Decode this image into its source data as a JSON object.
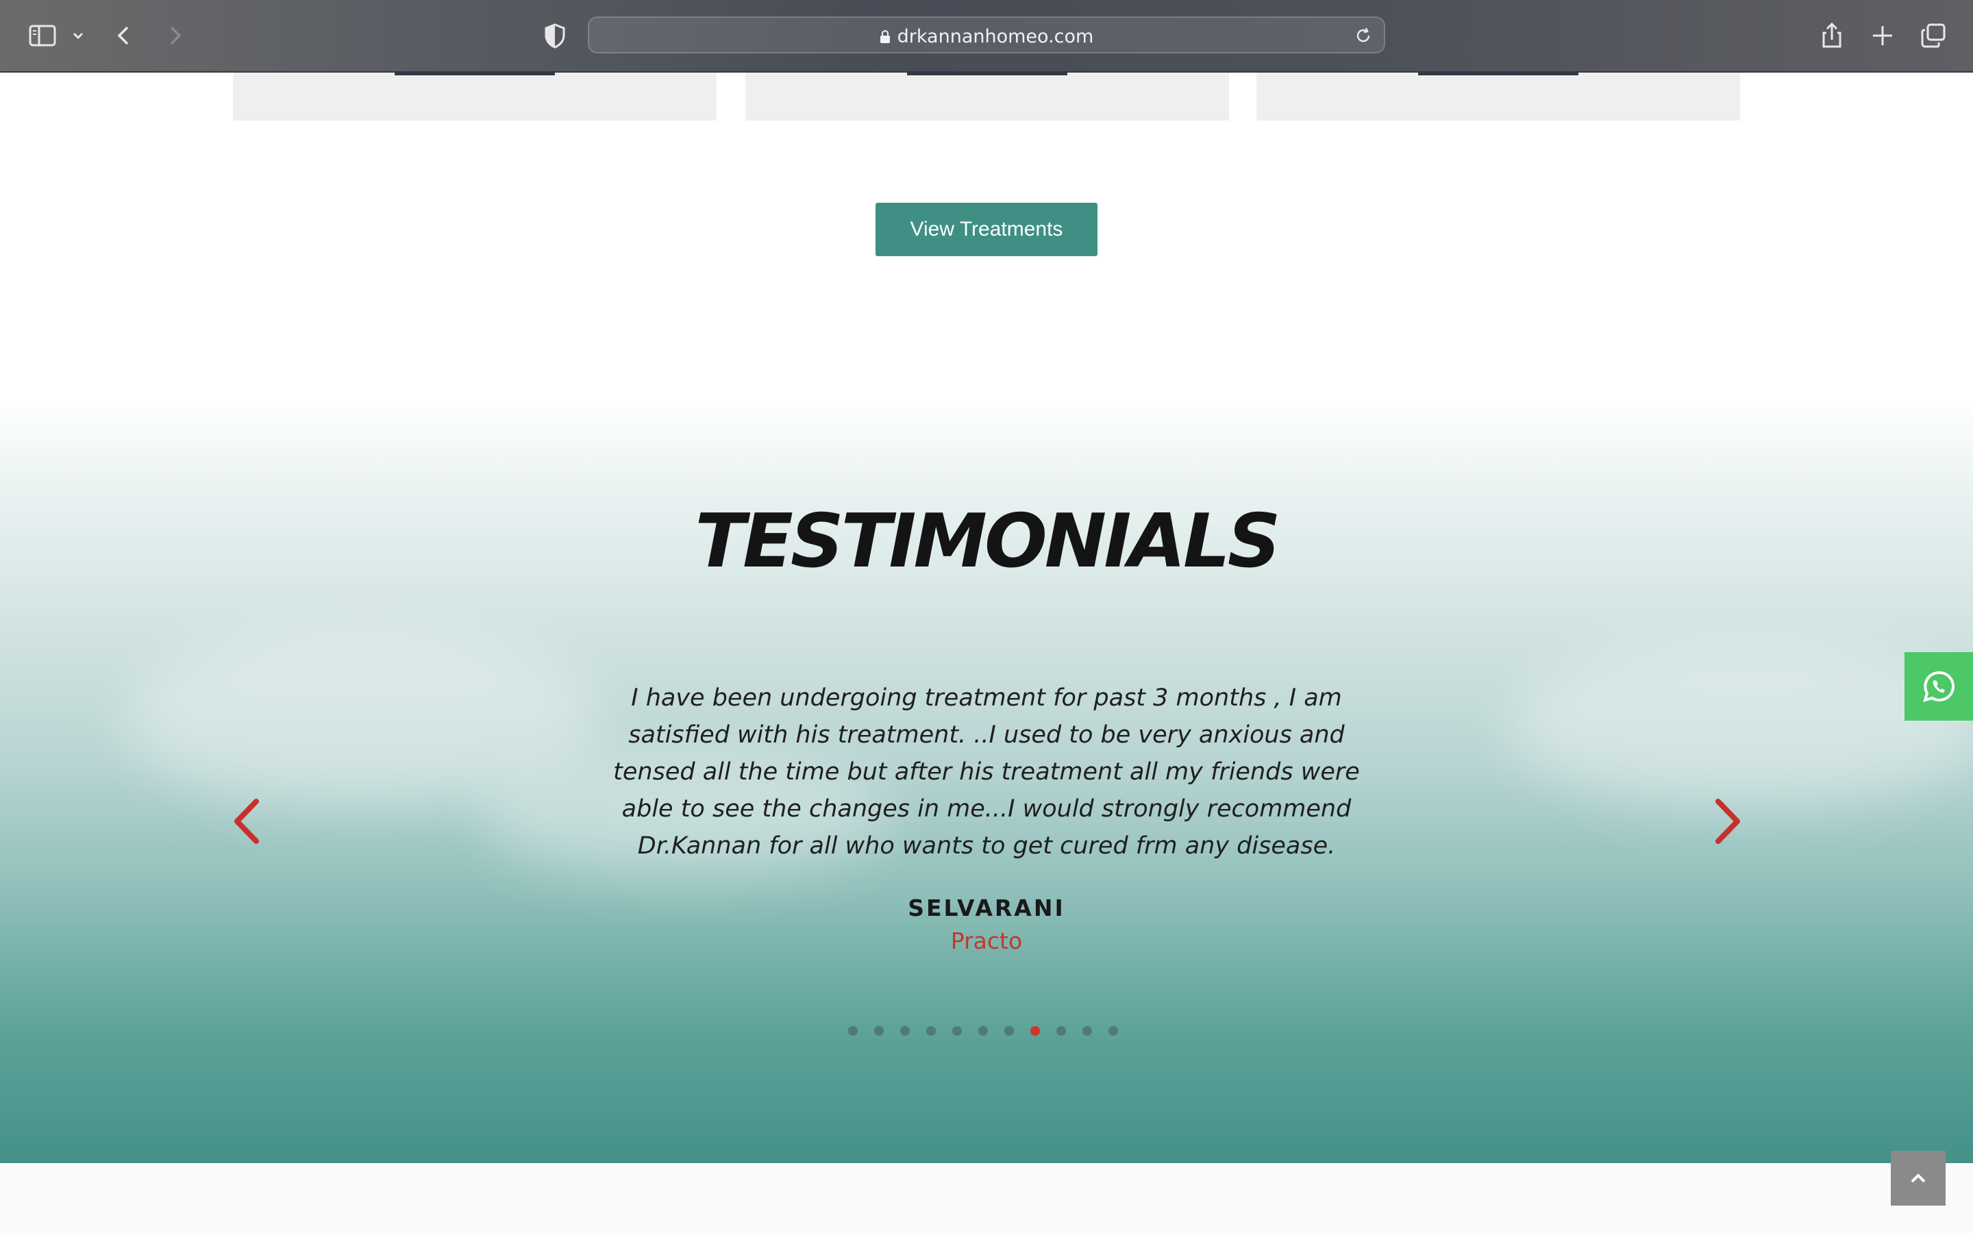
{
  "browser": {
    "url": "drkannanhomeo.com",
    "icons": [
      "sidebar-icon",
      "chevron-down-icon",
      "back-icon",
      "forward-icon",
      "shield-icon",
      "lock-icon",
      "reload-icon",
      "share-icon",
      "new-tab-icon",
      "tabs-overview-icon"
    ]
  },
  "treatments": {
    "view_button_label": "View Treatments"
  },
  "testimonials": {
    "title": "TESTIMONIALS",
    "quote": "I have been undergoing treatment for past 3 months , I am satisfied with his treatment. ..I used to be very anxious and tensed all the time but after his treatment all my friends were able to see the changes in me...I would strongly recommend Dr.Kannan for all who wants to get cured frm any disease.",
    "author": "SELVARANI",
    "source": "Practo",
    "slide_count": 11,
    "active_slide": 8
  },
  "colors": {
    "accent": "#3f8f85",
    "arrow": "#c8312b",
    "active_dot": "#d0342c",
    "whatsapp": "#4cc866"
  },
  "floating": {
    "whatsapp_icon": "whatsapp-icon",
    "scroll_top_icon": "chevron-up-icon"
  }
}
